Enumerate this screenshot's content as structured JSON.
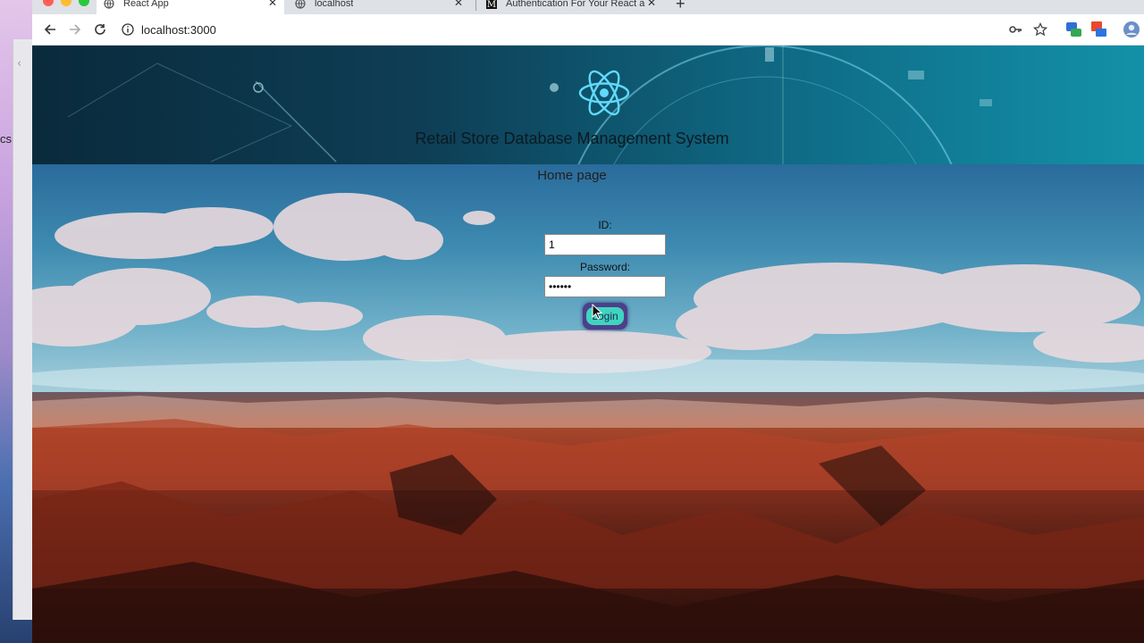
{
  "browser": {
    "tabs": [
      {
        "title": "React App",
        "active": true
      },
      {
        "title": "localhost",
        "active": false
      },
      {
        "title": "Authentication For Your React a",
        "active": false
      }
    ],
    "url": "localhost:3000"
  },
  "desktop": {
    "cs_text": "cs"
  },
  "page": {
    "header_title": "Retail Store Database Management System",
    "home_label": "Home page",
    "form": {
      "id_label": "ID:",
      "id_value": "1",
      "password_label": "Password:",
      "password_value": "••••••",
      "login_button": "Login"
    }
  },
  "colors": {
    "react_logo": "#61dafb",
    "login_button_bg": "#41d4c1",
    "login_button_ring": "#4d3f8a"
  }
}
